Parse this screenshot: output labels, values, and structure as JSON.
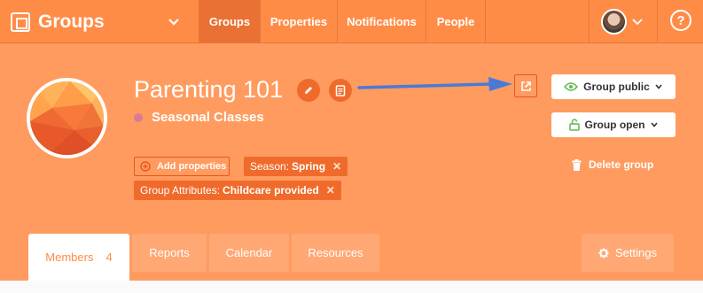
{
  "brand": {
    "name": "Groups",
    "icon": "groups-logo-icon"
  },
  "nav": {
    "items": [
      {
        "label": "Groups",
        "active": true
      },
      {
        "label": "Properties",
        "active": false
      },
      {
        "label": "Notifications",
        "active": false
      },
      {
        "label": "People",
        "active": false
      }
    ],
    "help_label": "?"
  },
  "group": {
    "title": "Parenting 101",
    "subtitle": "Seasonal Classes",
    "subtitle_dot_color": "#d97a9a"
  },
  "actions": {
    "visibility_label": "Group public",
    "status_label": "Group open",
    "delete_label": "Delete group",
    "add_properties_label": "Add properties"
  },
  "tags": [
    {
      "key": "Season:",
      "value": "Spring"
    },
    {
      "key": "Group Attributes:",
      "value": "Childcare provided"
    }
  ],
  "tabs": {
    "members_label": "Members",
    "members_count": "4",
    "reports_label": "Reports",
    "calendar_label": "Calendar",
    "resources_label": "Resources",
    "settings_label": "Settings"
  },
  "colors": {
    "brand": "#ff8c46",
    "header_bg": "#ff9b5f",
    "accent_dark": "#f06b2b",
    "annotation_arrow": "#4a7ad8"
  }
}
